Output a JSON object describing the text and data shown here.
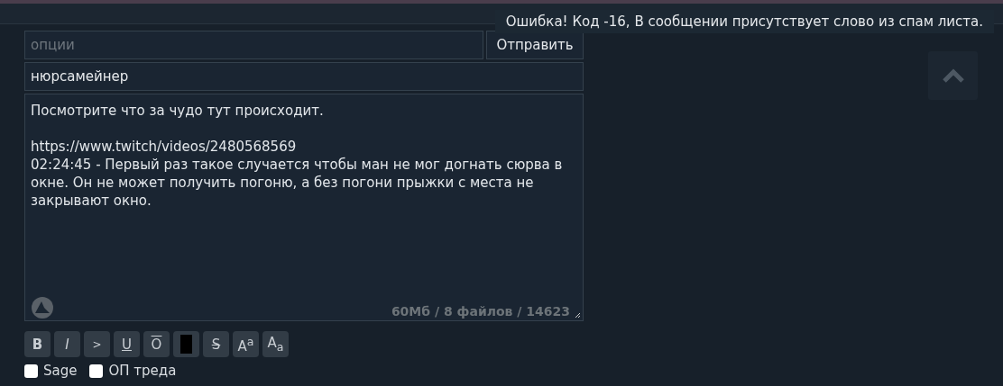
{
  "error_toast": {
    "text": "Ошибка! Код -16, В сообщении присутствует слово из спам листа."
  },
  "options_field": {
    "placeholder": "опции"
  },
  "send_button": {
    "label": "Отправить"
  },
  "name_field": {
    "value": "нюрсамейнер"
  },
  "message_field": {
    "value": "Посмотрите что за чудо тут происходит.\n\nhttps://www.twitch/videos/2480568569\n02:24:45 - Первый раз такое случается чтобы ман не мог догнать сюрва в окне. Он не может получить погоню, а без погони прыжки с места не закрывают окно."
  },
  "limits": "60Мб / 8 файлов / 14623",
  "format_buttons": [
    {
      "kind": "bold",
      "label": "B"
    },
    {
      "kind": "italic",
      "label": "I"
    },
    {
      "kind": "quote",
      "label": ">"
    },
    {
      "kind": "underline",
      "label": "U"
    },
    {
      "kind": "overline",
      "label": "O"
    },
    {
      "kind": "spoiler"
    },
    {
      "kind": "strike",
      "label": "S"
    },
    {
      "kind": "sup",
      "label": "A$^{a}$"
    },
    {
      "kind": "sub",
      "label": "A$_{a}$"
    }
  ],
  "checkboxes": [
    {
      "label": "Sage",
      "checked": false
    },
    {
      "label": "ОП треда",
      "checked": false
    }
  ]
}
